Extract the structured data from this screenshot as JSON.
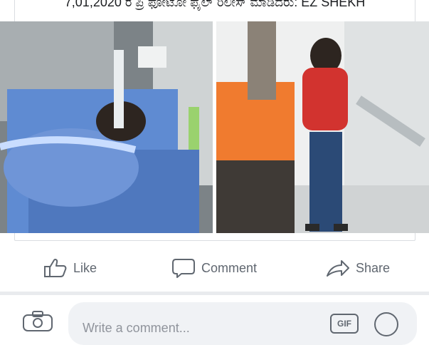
{
  "post": {
    "caption": "7,01,2020 ರ ಪ್ರಿ ಫೋಟೋ ಫೈಲ್ ರಿಲೀಸ್ ಮಾಡಿದರು: EZ SHEKH"
  },
  "actions": {
    "like": "Like",
    "comment": "Comment",
    "share": "Share"
  },
  "composer": {
    "placeholder": "Write a comment...",
    "gif_label": "GIF"
  },
  "colors": {
    "action_text": "#606770",
    "divider": "#e9ebee",
    "composer_bg": "#f0f2f5"
  }
}
